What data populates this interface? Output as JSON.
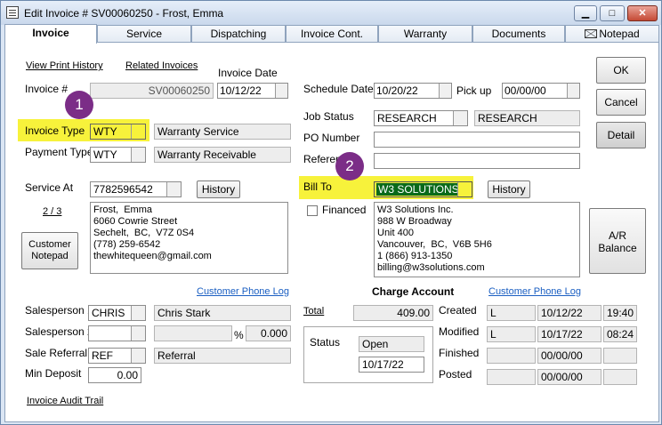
{
  "window": {
    "title": "Edit Invoice # SV00060250  -  Frost, Emma",
    "minimize": "▁",
    "maximize": "□",
    "close": "✕"
  },
  "tabs": [
    "Invoice",
    "Service",
    "Dispatching",
    "Invoice Cont.",
    "Warranty",
    "Documents",
    "Notepad"
  ],
  "links": {
    "view_print_history": "View Print History",
    "related_invoices": "Related Invoices",
    "customer_phone_log_left": "Customer Phone Log",
    "customer_phone_log_right": "Customer Phone Log",
    "invoice_audit_trail": "Invoice Audit Trail",
    "page_counter": "2 / 3",
    "total": "Total"
  },
  "labels": {
    "invoice_num": "Invoice #",
    "invoice_date": "Invoice Date",
    "invoice_type": "Invoice Type",
    "payment_type": "Payment Type",
    "service_at": "Service At",
    "schedule_date": "Schedule Date",
    "pick_up": "Pick up",
    "job_status": "Job Status",
    "po_number": "PO Number",
    "reference": "Referen",
    "bill_to": "Bill To",
    "financed": "Financed",
    "salesperson1": "Salesperson 1",
    "salesperson2": "Salesperson 2",
    "sale_referral": "Sale Referral",
    "min_deposit": "Min Deposit",
    "charge_account": "Charge Account",
    "status": "Status",
    "created": "Created",
    "modified": "Modified",
    "finished": "Finished",
    "posted": "Posted",
    "percent": "%"
  },
  "fields": {
    "invoice_num": "SV00060250",
    "invoice_date": "10/12/22",
    "invoice_type": "WTY",
    "invoice_type_desc": "Warranty Service",
    "payment_type": "WTY",
    "payment_type_desc": "Warranty Receivable",
    "service_at": "7782596542",
    "schedule_date": "10/20/22",
    "pick_up": "00/00/00",
    "job_status": "RESEARCH",
    "job_status_desc": "RESEARCH",
    "po_number": "",
    "reference": "",
    "bill_to": "W3 SOLUTIONS",
    "salesperson1": "CHRIS",
    "salesperson1_name": "Chris Stark",
    "salesperson2": "",
    "salesperson2_name": "",
    "salesperson2_pct": "0.000",
    "sale_referral": "REF",
    "sale_referral_desc": "Referral",
    "min_deposit": "0.00",
    "total": "409.00",
    "status": "Open",
    "status_date": "10/17/22",
    "created_by": "L",
    "created_date": "10/12/22",
    "created_time": "19:40",
    "modified_by": "L",
    "modified_date": "10/17/22",
    "modified_time": "08:24",
    "finished_by": "",
    "finished_date": "00/00/00",
    "finished_time": "",
    "posted_by": "",
    "posted_date": "00/00/00",
    "posted_time": ""
  },
  "service_address": "Frost,  Emma\n6060 Cowrie Street\nSechelt,  BC,  V7Z 0S4\n(778) 259-6542\nthewhitequeen@gmail.com",
  "bill_to_address": "W3 Solutions Inc.\n988 W Broadway\nUnit 400\nVancouver,  BC,  V6B 5H6\n1 (866) 913-1350\nbilling@w3solutions.com",
  "buttons": {
    "ok": "OK",
    "cancel": "Cancel",
    "detail": "Detail",
    "history_service": "History",
    "history_bill": "History",
    "customer_notepad_line1": "Customer",
    "customer_notepad_line2": "Notepad",
    "ar_line1": "A/R",
    "ar_line2": "Balance"
  },
  "annotations": [
    "1",
    "2"
  ],
  "colors": {
    "highlight": "#f7f23b",
    "badge": "#7b2d87",
    "bill_to_selection": "#0a6a1a",
    "link_blue": "#1b5fc2"
  }
}
